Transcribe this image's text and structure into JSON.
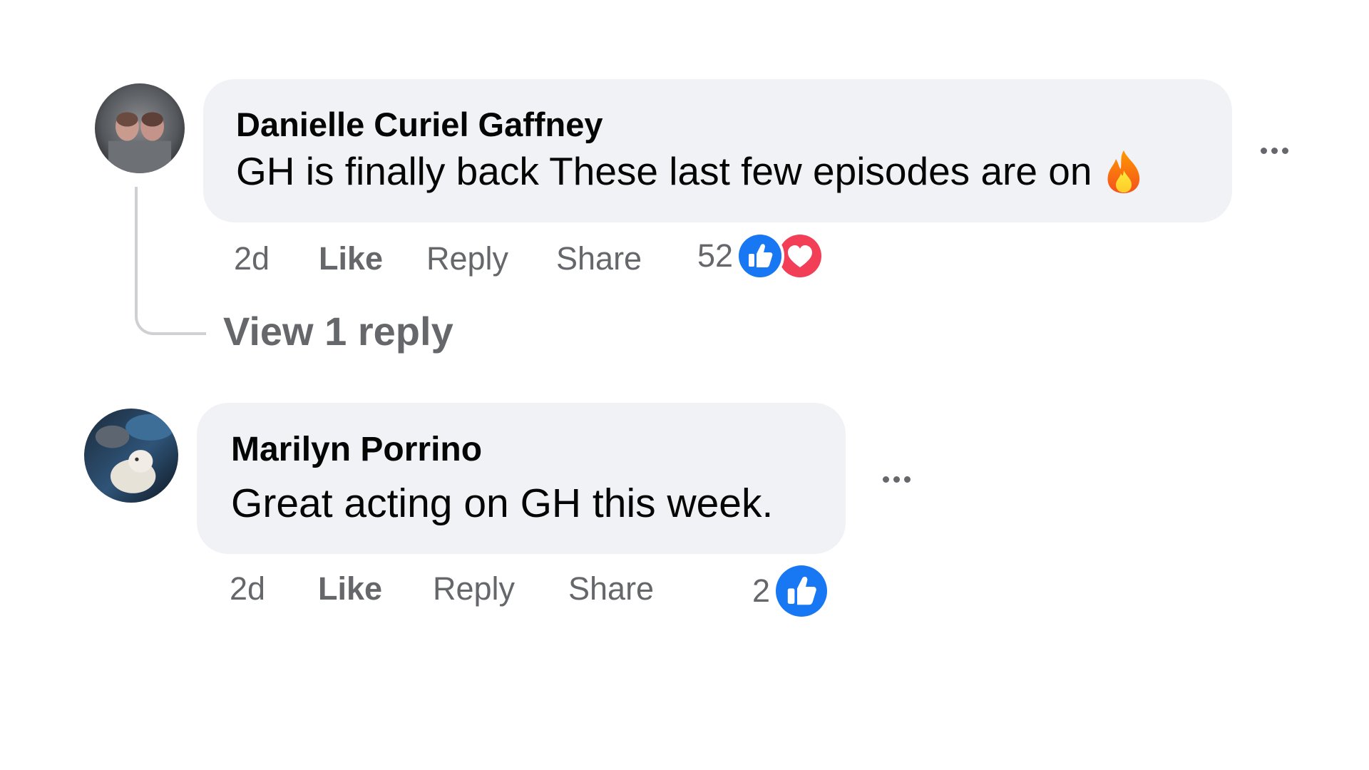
{
  "comments": [
    {
      "author": "Danielle Curiel Gaffney",
      "text": "GH is finally back These last few episodes are on",
      "emoji": "fire-emoji",
      "time": "2d",
      "like_label": "Like",
      "reply_label": "Reply",
      "share_label": "Share",
      "reaction_count": "52",
      "reactions": [
        "like-reaction-icon",
        "love-reaction-icon"
      ],
      "view_replies": "View 1 reply"
    },
    {
      "author": "Marilyn Porrino",
      "text": "Great acting on GH this week.",
      "time": "2d",
      "like_label": "Like",
      "reply_label": "Reply",
      "share_label": "Share",
      "reaction_count": "2",
      "reactions": [
        "like-reaction-icon"
      ]
    }
  ],
  "colors": {
    "bubble_bg": "#f0f2f5",
    "secondary_text": "#65676b",
    "primary_text": "#050505",
    "like_blue": "#1877f2",
    "love_red": "#f33e58",
    "thread_line": "#ced0d4"
  }
}
